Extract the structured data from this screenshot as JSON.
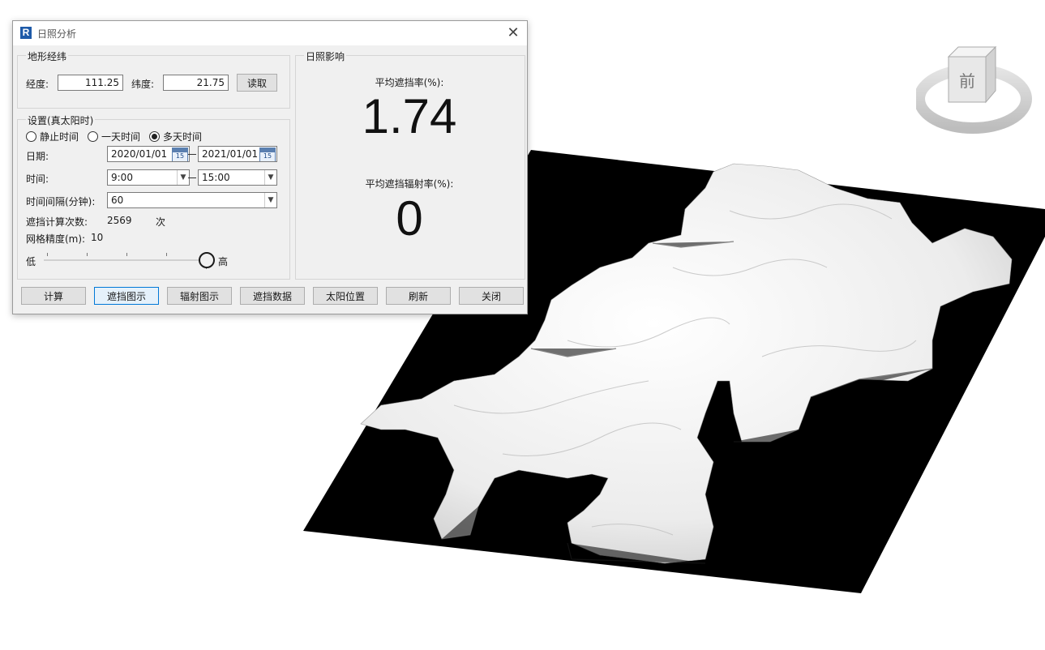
{
  "dialog": {
    "title": "日照分析",
    "app_icon_letter": "R",
    "close_glyph": "✕"
  },
  "terrain_group": {
    "title": "地形经纬",
    "longitude_label": "经度:",
    "longitude_value": "111.25",
    "latitude_label": "纬度:",
    "latitude_value": "21.75",
    "read_button": "读取"
  },
  "settings_group": {
    "title": "设置(真太阳时)",
    "radio_static": "静止时间",
    "radio_one_day": "一天时间",
    "radio_multi_day": "多天时间",
    "selected_radio": "多天时间",
    "date_label": "日期:",
    "date_start": "2020/01/01",
    "date_end": "2021/01/01",
    "calendar_day": "15",
    "time_label": "时间:",
    "time_start": "9:00",
    "time_end": "15:00",
    "interval_label": "时间间隔(分钟):",
    "interval_value": "60",
    "count_label": "遮挡计算次数:",
    "count_value": "2569",
    "count_unit": "次",
    "grid_label": "网格精度(m):",
    "grid_value": "10",
    "slider_low": "低",
    "slider_high": "高",
    "slider_level": 1.0
  },
  "impact_group": {
    "title": "日照影响",
    "avg_shade_label": "平均遮挡率(%):",
    "avg_shade_value": "1.74",
    "avg_rad_label": "平均遮挡辐射率(%):",
    "avg_rad_value": "0"
  },
  "buttons": {
    "calc": "计算",
    "shade_map": "遮挡图示",
    "rad_map": "辐射图示",
    "shade_data": "遮挡数据",
    "sun_pos": "太阳位置",
    "refresh": "刷新",
    "close": "关闭"
  },
  "viewcube": {
    "face_label": "前"
  },
  "colors": {
    "terrain": "#f2f2f2",
    "base_plate": "#000000",
    "focus_border": "#0078d7"
  }
}
